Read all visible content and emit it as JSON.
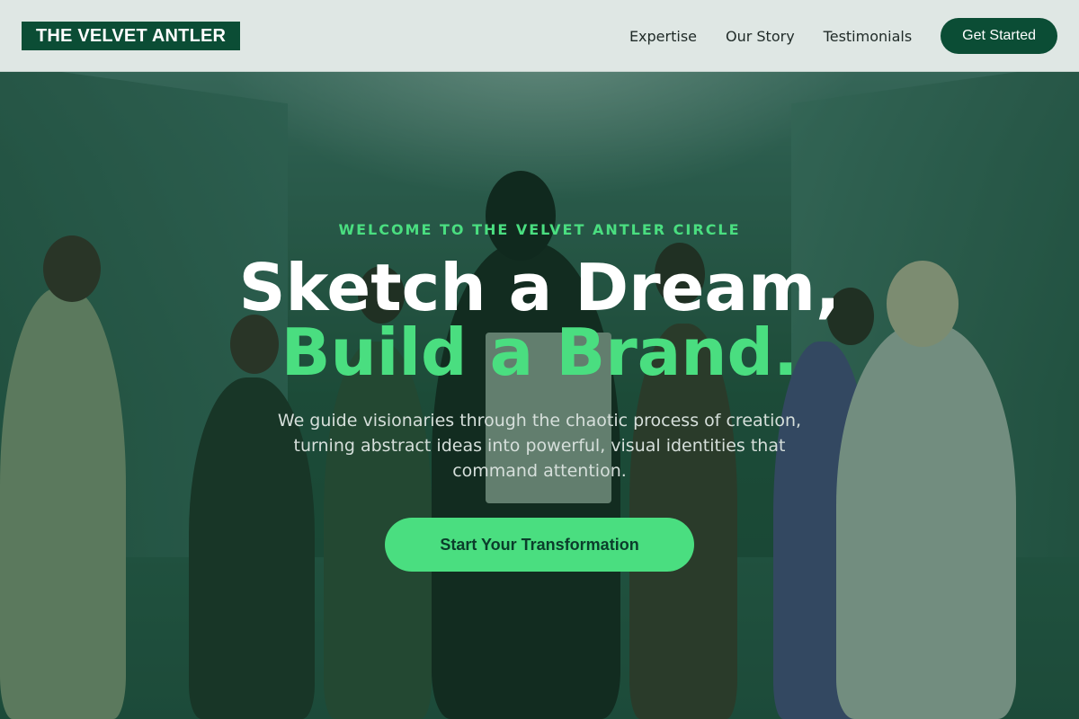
{
  "header": {
    "logo": "THE VELVET ANTLER",
    "nav": [
      "Expertise",
      "Our Story",
      "Testimonials"
    ],
    "cta": "Get Started"
  },
  "hero": {
    "eyebrow": "WELCOME TO THE VELVET ANTLER CIRCLE",
    "title_line1": "Sketch a Dream,",
    "title_line2": "Build a Brand.",
    "subtitle": "We guide visionaries through the chaotic process of creation, turning abstract ideas into powerful, visual identities that command attention.",
    "cta": "Start Your Transformation"
  },
  "colors": {
    "brand_dark_green": "#0b4d35",
    "accent_green": "#4ade80",
    "header_bg": "#dfe7e4"
  }
}
